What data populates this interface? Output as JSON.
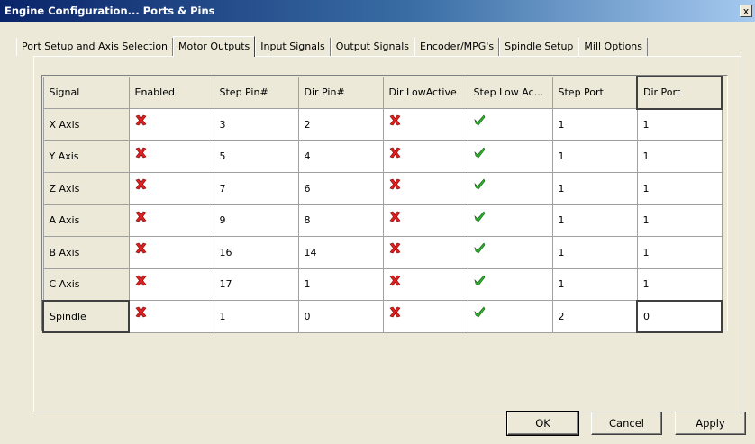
{
  "window": {
    "title": "Engine Configuration... Ports & Pins",
    "close_label": "x"
  },
  "tabs": [
    {
      "label": "Port Setup and Axis Selection",
      "active": false
    },
    {
      "label": "Motor Outputs",
      "active": true
    },
    {
      "label": "Input Signals",
      "active": false
    },
    {
      "label": "Output Signals",
      "active": false
    },
    {
      "label": "Encoder/MPG's",
      "active": false
    },
    {
      "label": "Spindle Setup",
      "active": false
    },
    {
      "label": "Mill Options",
      "active": false
    }
  ],
  "grid": {
    "columns": [
      "Signal",
      "Enabled",
      "Step Pin#",
      "Dir Pin#",
      "Dir LowActive",
      "Step Low Ac...",
      "Step Port",
      "Dir Port"
    ],
    "rows": [
      {
        "signal": "X Axis",
        "enabled": "cross",
        "step_pin": "3",
        "dir_pin": "2",
        "dir_low_active": "cross",
        "step_low_active": "check",
        "step_port": "1",
        "dir_port": "1"
      },
      {
        "signal": "Y Axis",
        "enabled": "cross",
        "step_pin": "5",
        "dir_pin": "4",
        "dir_low_active": "cross",
        "step_low_active": "check",
        "step_port": "1",
        "dir_port": "1"
      },
      {
        "signal": "Z Axis",
        "enabled": "cross",
        "step_pin": "7",
        "dir_pin": "6",
        "dir_low_active": "cross",
        "step_low_active": "check",
        "step_port": "1",
        "dir_port": "1"
      },
      {
        "signal": "A Axis",
        "enabled": "cross",
        "step_pin": "9",
        "dir_pin": "8",
        "dir_low_active": "cross",
        "step_low_active": "check",
        "step_port": "1",
        "dir_port": "1"
      },
      {
        "signal": "B Axis",
        "enabled": "cross",
        "step_pin": "16",
        "dir_pin": "14",
        "dir_low_active": "cross",
        "step_low_active": "check",
        "step_port": "1",
        "dir_port": "1"
      },
      {
        "signal": "C Axis",
        "enabled": "cross",
        "step_pin": "17",
        "dir_pin": "1",
        "dir_low_active": "cross",
        "step_low_active": "check",
        "step_port": "1",
        "dir_port": "1"
      },
      {
        "signal": "Spindle",
        "enabled": "cross",
        "step_pin": "1",
        "dir_pin": "0",
        "dir_low_active": "cross",
        "step_low_active": "check",
        "step_port": "2",
        "dir_port": "0"
      }
    ],
    "cross_color": "#e02020",
    "check_color": "#30b030"
  },
  "buttons": {
    "ok": "OK",
    "cancel": "Cancel",
    "apply": "Apply"
  }
}
